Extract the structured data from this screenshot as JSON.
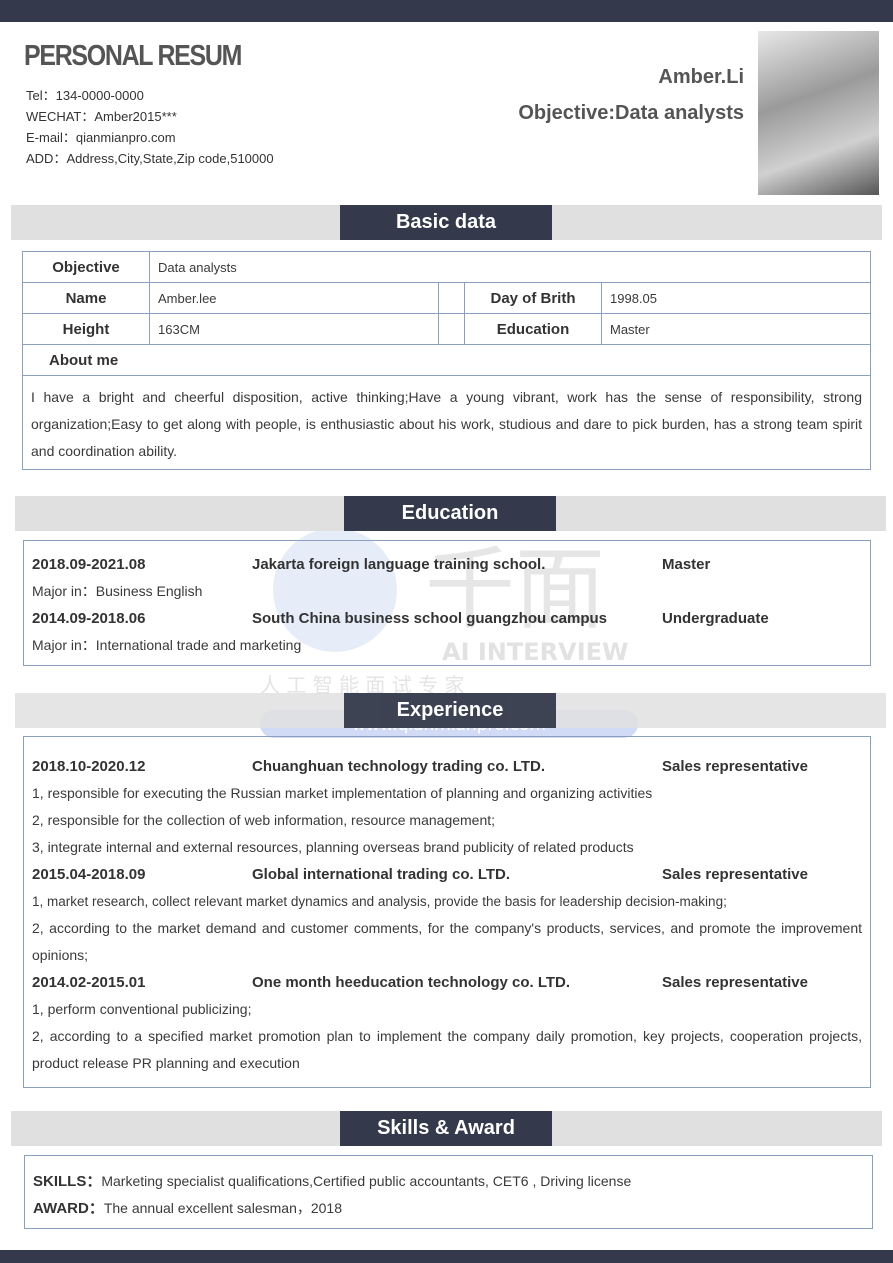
{
  "header": {
    "title": "PERSONAL RESUM",
    "contacts": [
      "Tel：134-0000-0000",
      "WECHAT：Amber2015***",
      "E-mail：qianmianpro.com",
      "ADD：Address,City,State,Zip code,510000"
    ],
    "name": "Amber.Li",
    "objective": "Objective:Data analysts"
  },
  "basic": {
    "heading": "Basic data",
    "objective_label": "Objective",
    "objective": "Data analysts",
    "name_label": "Name",
    "name": "Amber.lee",
    "birth_label": "Day of Brith",
    "birth": "1998.05",
    "height_label": "Height",
    "height": "163CM",
    "education_label": "Education",
    "education": "Master",
    "about_label": "About me",
    "about": "I have a bright and cheerful disposition, active thinking;Have a young vibrant, work has the sense of responsibility, strong organization;Easy to get along with people, is enthusiastic about his work, studious and dare to pick burden, has a strong team spirit and coordination ability."
  },
  "education": {
    "heading": "Education",
    "items": [
      {
        "date": "2018.09-2021.08",
        "school": "Jakarta foreign language training school.",
        "degree": "Master",
        "major": "Major in：Business English"
      },
      {
        "date": "2014.09-2018.06",
        "school": "South China business school guangzhou campus",
        "degree": "Undergraduate",
        "major": "Major in：International trade and marketing"
      }
    ]
  },
  "experience": {
    "heading": "Experience",
    "items": [
      {
        "date": "2018.10-2020.12",
        "company": "Chuanghuan technology trading co. LTD.",
        "role": "Sales representative",
        "duties": [
          "1, responsible for executing the Russian market implementation of planning and organizing activities",
          "2, responsible for the collection of web information, resource management;",
          "3, integrate internal and external resources, planning overseas brand publicity of related products"
        ]
      },
      {
        "date": "2015.04-2018.09",
        "company": "Global international trading co. LTD.",
        "role": "Sales representative",
        "duties": [
          "1, market research, collect relevant market dynamics and analysis, provide the basis for leadership decision-making;",
          "2, according to the market demand and customer comments, for the company's products, services, and promote the improvement opinions;"
        ]
      },
      {
        "date": "2014.02-2015.01",
        "company": "One month heeducation technology co. LTD.",
        "role": "Sales representative",
        "duties": [
          "1, perform conventional publicizing;",
          "2, according to a specified market promotion plan to implement the company daily promotion, key projects, cooperation projects, product release PR planning and execution"
        ]
      }
    ]
  },
  "skills": {
    "heading": "Skills & Award",
    "skills_label": "SKILLS：",
    "skills": "Marketing specialist qualifications,Certified public accountants, CET6 , Driving license",
    "award_label": "AWARD：",
    "award": "The annual excellent salesman，2018"
  },
  "watermark": {
    "brand": "千面",
    "sub": "AI INTERVIEW",
    "tagline": "人 工 智 能   面 试 专 家",
    "url": "www.qianmianpro.com"
  }
}
